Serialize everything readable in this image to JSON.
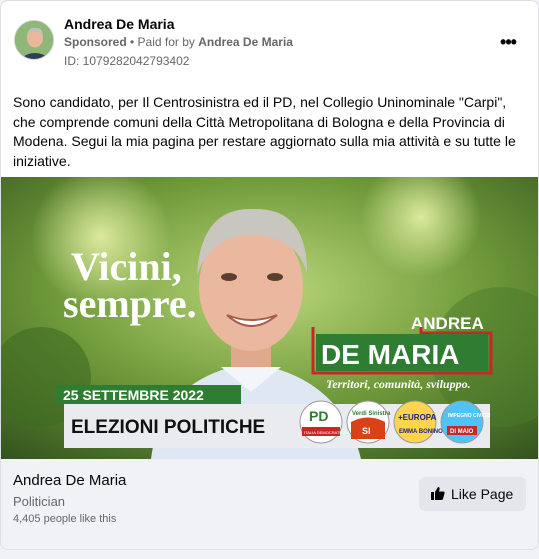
{
  "post": {
    "page_name": "Andrea De Maria",
    "sponsored": "Sponsored",
    "paid_for_prefix": " • Paid for by ",
    "paid_for_name": "Andrea De Maria",
    "ad_id": "ID: 1079282042793402",
    "more_icon": "more-dots-icon",
    "body": "Sono candidato, per Il Centrosinistra ed il PD, nel Collegio Uninominale \"Carpi\", che comprende comuni della Città Metropolitana di Bologna e della Provincia di Modena. Segui la mia pagina per restare aggiornato sulla mia attività e su tutte le iniziative."
  },
  "creative": {
    "slogan_line1": "Vicini,",
    "slogan_line2": "sempre.",
    "candidate_first": "ANDREA",
    "candidate_last": "DE MARIA",
    "tagline": "Territori, comunità, sviluppo.",
    "date": "25 SETTEMBRE 2022",
    "election": "ELEZIONI POLITICHE",
    "logos": [
      {
        "top": "PD",
        "bottom": "ITALIA DEMOCRATICA E PROGRESSISTA"
      },
      {
        "top": "Verdi Sinistra",
        "bottom": "SI"
      },
      {
        "top": "+EUROPA",
        "bottom": "EMMA BONINO"
      },
      {
        "top": "IMPEGNO CIVICO",
        "bottom": "DI MAIO"
      }
    ],
    "colors": {
      "green": "#2e7d32",
      "red": "#c62828",
      "banner": "#e9ebee"
    }
  },
  "footer": {
    "page_name": "Andrea De Maria",
    "category": "Politician",
    "likes": "4,405 people like this",
    "like_button": "Like Page",
    "like_icon": "thumbs-up-icon"
  }
}
